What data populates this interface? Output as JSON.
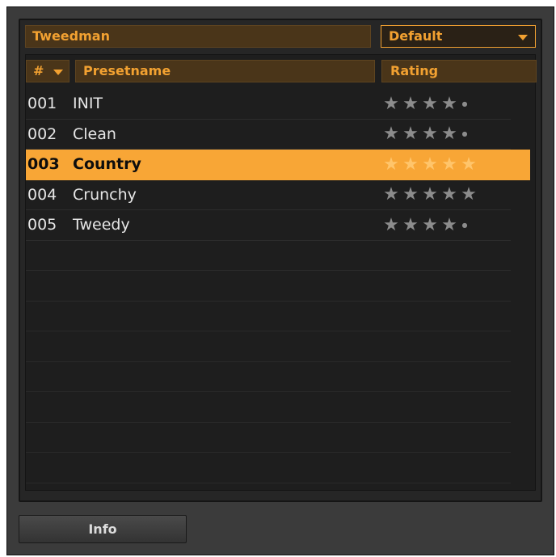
{
  "bank": {
    "name": "Tweedman",
    "select_value": "Default"
  },
  "columns": {
    "num": "#",
    "name": "Presetname",
    "rating": "Rating"
  },
  "presets": [
    {
      "num": "001",
      "name": "INIT",
      "rating": 4,
      "selected": false
    },
    {
      "num": "002",
      "name": "Clean",
      "rating": 4,
      "selected": false
    },
    {
      "num": "003",
      "name": "Country",
      "rating": 5,
      "selected": true
    },
    {
      "num": "004",
      "name": "Crunchy",
      "rating": 5,
      "selected": false
    },
    {
      "num": "005",
      "name": "Tweedy",
      "rating": 4,
      "selected": false
    }
  ],
  "max_rating": 5,
  "footer": {
    "info_label": "Info"
  },
  "colors": {
    "accent": "#f2a131",
    "selected_row": "#f8a636",
    "panel_bg": "#262626"
  }
}
